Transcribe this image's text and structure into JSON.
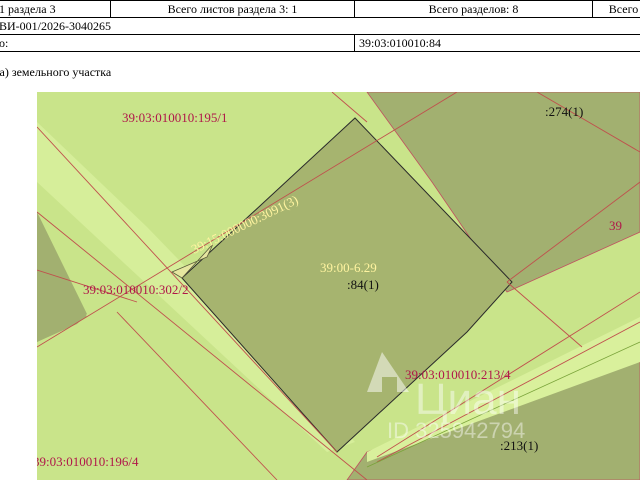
{
  "header": {
    "sheet_of_section": "1 раздела 3",
    "total_sheets": "Всего листов раздела 3: 1",
    "total_sections": "Всего разделов: 8",
    "total_cut": "Всего",
    "record_number": "ВИ-001/2026-3040265",
    "cadastral_label": "о:",
    "cadastral_value": "39:03:010010:84"
  },
  "caption": "ма) земельного участка",
  "map_labels": {
    "parcel_195": "39:03:010010:195/1",
    "parcel_274": ":274(1)",
    "parcel_15": "39:15:000000:3091(3)",
    "zone": "39:00-6.29",
    "parcel_84": ":84(1)",
    "parcel_302": "39:03:010010:302/2",
    "parcel_213_4": "39:03:010010:213/4",
    "parcel_213": ":213(1)",
    "parcel_196": "39:03:010010:196/4",
    "parcel_39_right": "39"
  },
  "watermark": {
    "brand": "Циан",
    "id": "ID 325942794"
  }
}
